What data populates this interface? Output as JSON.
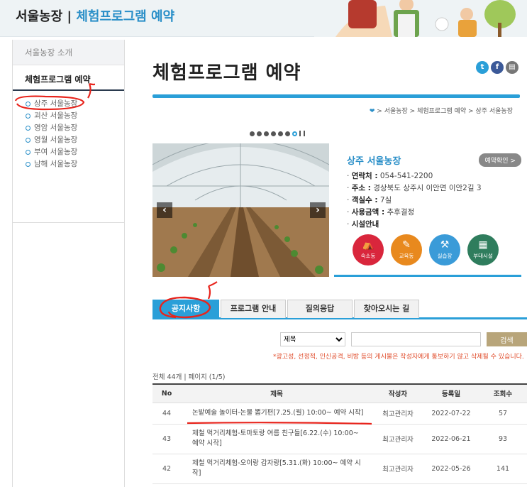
{
  "header": {
    "site": "서울농장",
    "separator": " | ",
    "section": "체험프로그램 예약"
  },
  "sidebar": {
    "top_item": "서울농장 소개",
    "active_item": "체험프로그램 예약",
    "farms": [
      "상주 서울농장",
      "괴산 서울농장",
      "영암 서울농장",
      "영월 서울농장",
      "부여 서울농장",
      "남해 서울농장"
    ]
  },
  "page": {
    "title": "체험프로그램 예약"
  },
  "breadcrumb": [
    "서울농장",
    "체험프로그램 예약",
    "상주 서울농장"
  ],
  "slider": {
    "dot_count": 7,
    "active_dot": 6
  },
  "farm": {
    "name": "상주 서울농장",
    "reserve_button": "예약확인 >",
    "rows": [
      {
        "label": "연락처 :",
        "value": " 054-541-2200"
      },
      {
        "label": "주소 :",
        "value": " 경상북도 상주시 이안면 이안2길 3"
      },
      {
        "label": "객실수 :",
        "value": " 7실"
      },
      {
        "label": "사용금액 :",
        "value": " 추후결정"
      },
      {
        "label": "시설안내",
        "value": ""
      }
    ],
    "facilities": [
      {
        "label": "숙소동",
        "icon": "bed-icon",
        "color": "#d9263c"
      },
      {
        "label": "교육동",
        "icon": "edit-icon",
        "color": "#e8891e"
      },
      {
        "label": "실습장",
        "icon": "tools-icon",
        "color": "#3a9bd8"
      },
      {
        "label": "부대시설",
        "icon": "building-icon",
        "color": "#2f7d5d"
      }
    ]
  },
  "tabs": [
    "공지사항",
    "프로그램 안내",
    "질의응답",
    "찾아오시는 길"
  ],
  "search": {
    "option": "제목",
    "button": "검색"
  },
  "notice_text": "*광고성, 선정적, 인신공격, 비방 등의 게시물은 작성자에게 통보하기 않고 삭제될 수 있습니다.",
  "count_text": "전체 44개 | 페이지 (1/5)",
  "table": {
    "headers": [
      "No",
      "제목",
      "작성자",
      "등록일",
      "조회수"
    ],
    "rows": [
      {
        "no": "44",
        "title": "논밭예술 놀이터-논물 뽑기편[7.25.(월) 10:00~ 예약 시작]",
        "author": "최고관리자",
        "date": "2022-07-22",
        "views": "57"
      },
      {
        "no": "43",
        "title": "제철 먹거리체험-토마토랑 여름 친구들[6.22.(수) 10:00~ 예약 시작]",
        "author": "최고관리자",
        "date": "2022-06-21",
        "views": "93"
      },
      {
        "no": "42",
        "title": "제철 먹거리체험-오이랑 감자랑[5.31.(화) 10:00~ 예약 시작]",
        "author": "최고관리자",
        "date": "2022-05-26",
        "views": "141"
      }
    ]
  },
  "sns": [
    {
      "name": "twitter-icon",
      "glyph": "t",
      "color": "#2a9fd8"
    },
    {
      "name": "facebook-icon",
      "glyph": "f",
      "color": "#3b5998"
    },
    {
      "name": "print-icon",
      "glyph": "▤",
      "color": "#777"
    }
  ]
}
